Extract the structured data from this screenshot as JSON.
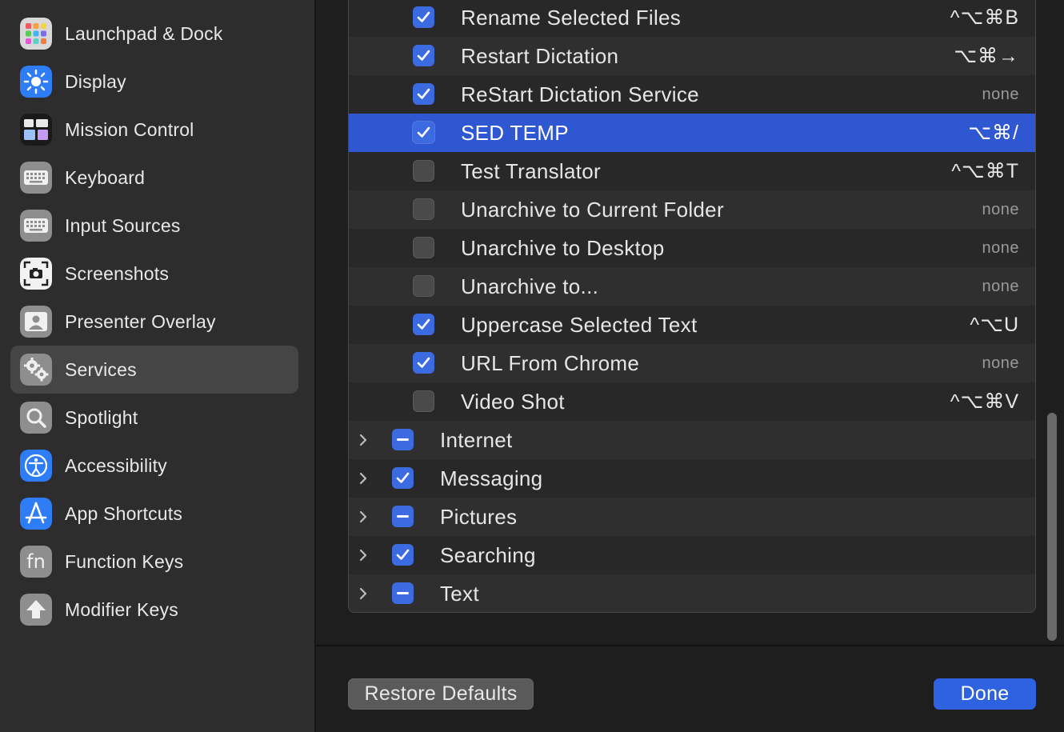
{
  "sidebar": {
    "items": [
      {
        "label": "Launchpad & Dock",
        "icon": "launchpad-icon"
      },
      {
        "label": "Display",
        "icon": "display-icon"
      },
      {
        "label": "Mission Control",
        "icon": "mission-control-icon"
      },
      {
        "label": "Keyboard",
        "icon": "keyboard-icon"
      },
      {
        "label": "Input Sources",
        "icon": "input-sources-icon"
      },
      {
        "label": "Screenshots",
        "icon": "screenshots-icon"
      },
      {
        "label": "Presenter Overlay",
        "icon": "presenter-overlay-icon"
      },
      {
        "label": "Services",
        "icon": "services-icon",
        "selected": true
      },
      {
        "label": "Spotlight",
        "icon": "spotlight-icon"
      },
      {
        "label": "Accessibility",
        "icon": "accessibility-icon"
      },
      {
        "label": "App Shortcuts",
        "icon": "app-shortcuts-icon"
      },
      {
        "label": "Function Keys",
        "icon": "function-keys-icon",
        "glyph": "fn"
      },
      {
        "label": "Modifier Keys",
        "icon": "modifier-keys-icon"
      }
    ]
  },
  "services": {
    "rows": [
      {
        "label": "Rename Selected Files",
        "checked": "on",
        "shortcut": "^⌥⌘B"
      },
      {
        "label": "Restart Dictation",
        "checked": "on",
        "shortcut": "⌥⌘→"
      },
      {
        "label": "ReStart Dictation Service",
        "checked": "on",
        "shortcut": "none"
      },
      {
        "label": "SED TEMP",
        "checked": "on",
        "shortcut": "⌥⌘/",
        "selected": true
      },
      {
        "label": "Test Translator",
        "checked": "off",
        "shortcut": "^⌥⌘T"
      },
      {
        "label": "Unarchive to Current Folder",
        "checked": "off",
        "shortcut": "none"
      },
      {
        "label": "Unarchive to Desktop",
        "checked": "off",
        "shortcut": "none"
      },
      {
        "label": "Unarchive to...",
        "checked": "off",
        "shortcut": "none"
      },
      {
        "label": "Uppercase Selected Text",
        "checked": "on",
        "shortcut": "^⌥U"
      },
      {
        "label": "URL From Chrome",
        "checked": "on",
        "shortcut": "none"
      },
      {
        "label": "Video Shot",
        "checked": "off",
        "shortcut": "^⌥⌘V"
      }
    ],
    "categories": [
      {
        "label": "Internet",
        "checked": "mixed"
      },
      {
        "label": "Messaging",
        "checked": "on"
      },
      {
        "label": "Pictures",
        "checked": "mixed"
      },
      {
        "label": "Searching",
        "checked": "on"
      },
      {
        "label": "Text",
        "checked": "mixed"
      }
    ]
  },
  "buttons": {
    "restore_defaults": "Restore Defaults",
    "done": "Done"
  },
  "colors": {
    "accent": "#2f62e0",
    "selection": "#2f57d2",
    "sidebar_bg": "#2d2d2d"
  }
}
